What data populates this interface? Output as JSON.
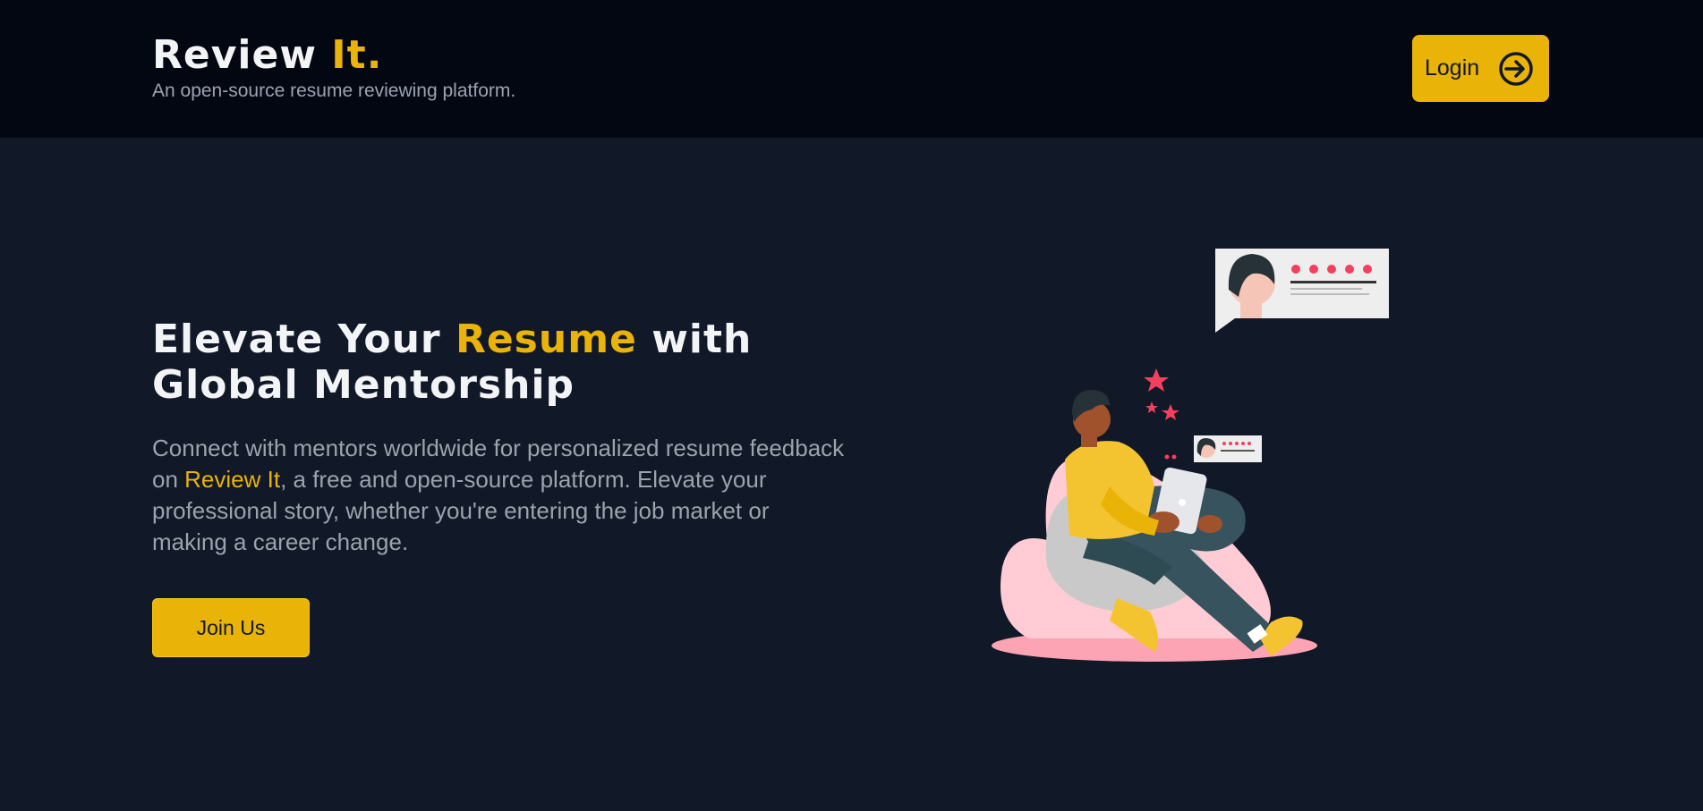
{
  "header": {
    "brand_main": "Review ",
    "brand_accent": "It.",
    "tagline": "An open-source resume reviewing platform.",
    "login_label": "Login",
    "login_icon": "arrow-right-circle-icon"
  },
  "hero": {
    "headline_part1": "Elevate Your ",
    "headline_accent": "Resume",
    "headline_part2": " with Global Mentorship",
    "desc_part1": "Connect with mentors worldwide for personalized resume feedback on ",
    "desc_accent": "Review It",
    "desc_part2": ", a free and open-source platform. Elevate your professional story, whether you're entering the job market or making a career change.",
    "join_label": "Join Us",
    "illustration_icon": "person-reviewing-resume-illustration"
  },
  "colors": {
    "accent": "#eab308",
    "header_bg": "#030712",
    "page_bg": "#111827",
    "muted_text": "#9ca3af",
    "star": "#f43f5e"
  }
}
